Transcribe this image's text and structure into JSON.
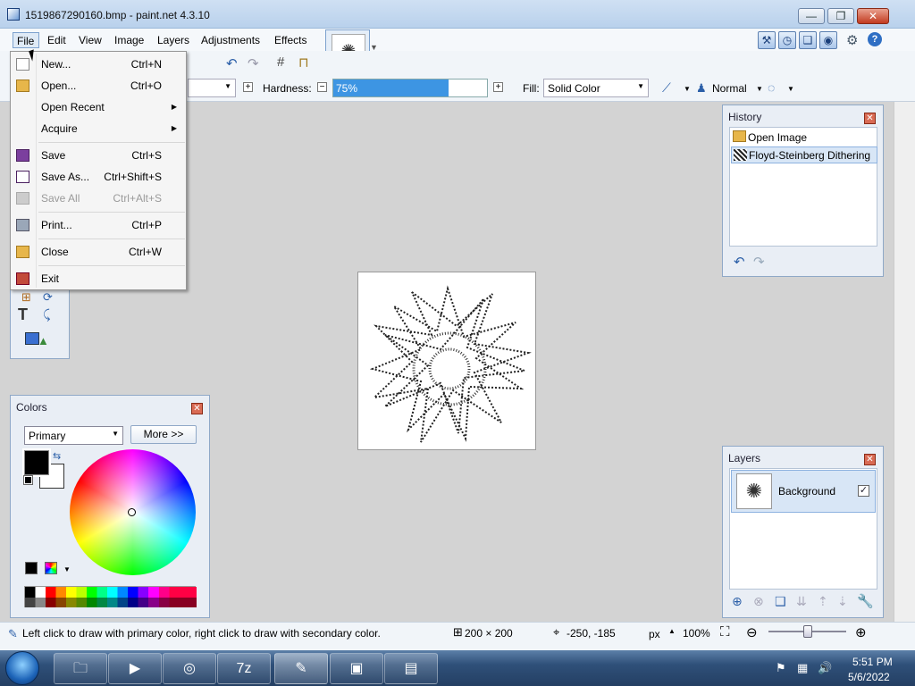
{
  "window": {
    "title": "1519867290160.bmp - paint.net 4.3.10",
    "minimize": "—",
    "maximize": "❐",
    "close": "✕"
  },
  "menubar": {
    "items": [
      "File",
      "Edit",
      "View",
      "Image",
      "Layers",
      "Adjustments",
      "Effects"
    ]
  },
  "toolbar": {
    "hardness_label": "Hardness:",
    "hardness_value": "75%",
    "hardness_fraction": 0.75,
    "fill_label": "Fill:",
    "fill_value": "Solid Color",
    "blend_value": "Normal"
  },
  "file_menu": {
    "items": [
      {
        "label": "New...",
        "shortcut": "Ctrl+N"
      },
      {
        "label": "Open...",
        "shortcut": "Ctrl+O"
      },
      {
        "label": "Open Recent",
        "shortcut": ""
      },
      {
        "label": "Acquire",
        "shortcut": ""
      },
      {
        "label": "Save",
        "shortcut": "Ctrl+S"
      },
      {
        "label": "Save As...",
        "shortcut": "Ctrl+Shift+S"
      },
      {
        "label": "Save All",
        "shortcut": "Ctrl+Alt+S"
      },
      {
        "label": "Print...",
        "shortcut": "Ctrl+P"
      },
      {
        "label": "Close",
        "shortcut": "Ctrl+W"
      },
      {
        "label": "Exit",
        "shortcut": ""
      }
    ]
  },
  "history": {
    "title": "History",
    "items": [
      "Open Image",
      "Floyd-Steinberg Dithering"
    ]
  },
  "layers": {
    "title": "Layers",
    "items": [
      {
        "name": "Background"
      }
    ]
  },
  "colors": {
    "title": "Colors",
    "mode": "Primary",
    "more_button": "More >>",
    "primary": "#000000",
    "secondary": "#ffffff"
  },
  "status": {
    "hint": "Left click to draw with primary color, right click to draw with secondary color.",
    "image_size": "200 × 200",
    "cursor_pos": "-250, -185",
    "units": "px",
    "zoom": "100%"
  },
  "taskbar": {
    "time": "5:51 PM",
    "date": "5/6/2022"
  }
}
